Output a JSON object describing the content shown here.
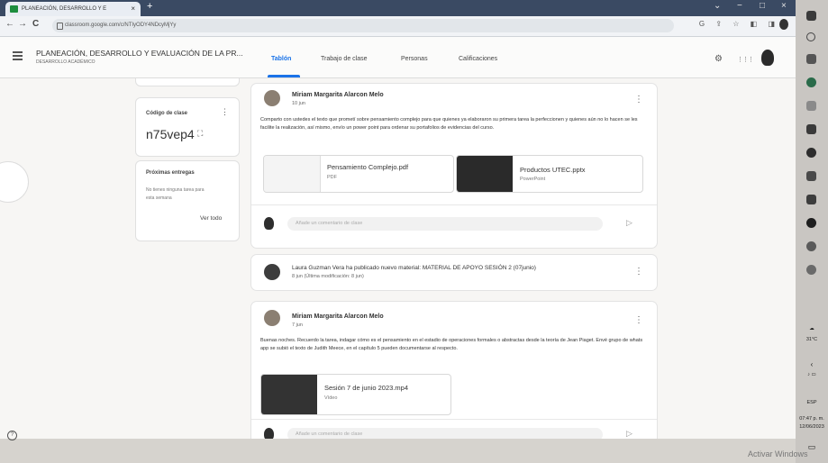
{
  "browser": {
    "tab_title": "PLANEACIÓN, DESARROLLO Y E",
    "tab_close": "×",
    "new_tab": "+",
    "url": "classroom.google.com/c/NTIyODY4NDcyMjYy",
    "back": "←",
    "forward": "→",
    "reload": "C",
    "window_controls": [
      "⌄",
      "−",
      "□",
      "×"
    ],
    "toolbar_icons": "G ⇪ ☆ ◧ ◨"
  },
  "header": {
    "class_title": "PLANEACIÓN, DESARROLLO Y EVALUACIÓN DE LA PR...",
    "class_subtitle": "DESARROLLO ACADÉMICO",
    "tabs": [
      {
        "label": "Tablón",
        "active": true
      },
      {
        "label": "Trabajo de clase",
        "active": false
      },
      {
        "label": "Personas",
        "active": false
      },
      {
        "label": "Calificaciones",
        "active": false
      }
    ],
    "settings_icon": "⚙",
    "apps_icon": "⋮⋮⋮"
  },
  "sidebar": {
    "class_code_label": "Código de clase",
    "class_code_menu": "⋮",
    "class_code": "n75vep4",
    "expand_icon": "⛶",
    "upcoming_title": "Próximas entregas",
    "upcoming_text": "No tienes ninguna tarea para esta semana",
    "view_all": "Ver todo"
  },
  "posts": [
    {
      "author": "Miriam Margarita Alarcon Melo",
      "date": "10 jun",
      "menu": "⋮",
      "body": "Comparto con ustedes el texto que prometí sobre pensamiento complejo para que quienes ya elaboraron su primera tarea la perfeccionen y quienes aún no lo hacen se les facilite la realización, así mismo, envío un power point para ordenar su portafolios de evidencias del curso.",
      "attachments": [
        {
          "name": "Pensamiento Complejo.pdf",
          "type": "PDF"
        },
        {
          "name": "Productos UTEC.pptx",
          "type": "PowerPoint"
        }
      ],
      "comment_placeholder": "Añade un comentario de clase",
      "send_icon": "▷"
    },
    {
      "material_title": "Laura Guzman Vera ha publicado nuevo material: MATERIAL DE APOYO SESIÓN 2 (07junio)",
      "material_date": "8 jun (Última modificación: 8 jun)",
      "menu": "⋮"
    },
    {
      "author": "Miriam Margarita Alarcon Melo",
      "date": "7 jun",
      "menu": "⋮",
      "body": "Buenas noches. Recuerdo la tarea, indagar cómo es el pensamiento en el estadio de operaciones formales o abstractas desde la teoría de Jean Piaget. Envé grupo de whats app se subió el texto de Judith Meece, en el capítulo 5 pueden documentarse al respecto.",
      "attachments": [
        {
          "name": "Sesión 7 de junio 2023.mp4",
          "type": "Vídeo"
        }
      ],
      "comment_placeholder": "Añade un comentario de clase",
      "send_icon": "▷"
    }
  ],
  "taskbar": {
    "temperature": "31°C",
    "time": "07:47 p. m.",
    "date": "12/06/2023",
    "lang": "ESP",
    "arrow": "‹"
  },
  "help_icon": "?",
  "watermark": "Activar Windows",
  "colors": {
    "accent": "#1a73e8",
    "chrome": "#3a4a63"
  }
}
